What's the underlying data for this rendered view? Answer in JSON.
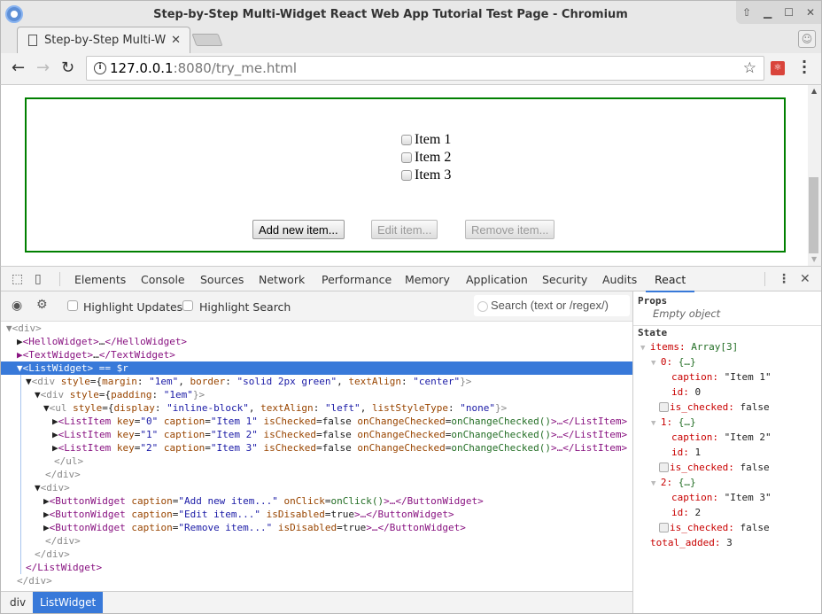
{
  "window": {
    "title": "Step-by-Step Multi-Widget React Web App Tutorial Test Page - Chromium"
  },
  "tab": {
    "label": "Step-by-Step Multi-W"
  },
  "address": {
    "host": "127.0.0.1",
    "rest": ":8080/try_me.html"
  },
  "page": {
    "items": [
      "Item 1",
      "Item 2",
      "Item 3"
    ],
    "buttons": {
      "add": "Add new item...",
      "edit": "Edit item...",
      "remove": "Remove item..."
    },
    "border_color": "#008000"
  },
  "devtools": {
    "tabs": [
      "Elements",
      "Console",
      "Sources",
      "Network",
      "Performance",
      "Memory",
      "Application",
      "Security",
      "Audits",
      "React"
    ],
    "active_tab": "React",
    "highlight_updates": "Highlight Updates",
    "highlight_search": "Highlight Search",
    "search_placeholder": "Search (text or /regex/)",
    "tree": {
      "r0": "<div>",
      "r1a": "<HelloWidget>",
      "r1b": "…",
      "r1c": "</HelloWidget>",
      "r2a": "<TextWidget>",
      "r2b": "…",
      "r2c": "</TextWidget>",
      "r3a": "<ListWidget>",
      "r3b": " == $r",
      "r4a": "<div ",
      "r4b": "style",
      "r4c": "={",
      "r4d": "margin",
      "r4e": ": ",
      "r4f": "\"1em\"",
      "r4g": ", ",
      "r4h": "border",
      "r4i": ": ",
      "r4j": "\"solid 2px green\"",
      "r4k": ", ",
      "r4l": "textAlign",
      "r4m": ": ",
      "r4n": "\"center\"",
      "r4o": "}>",
      "r5a": "<div ",
      "r5b": "style",
      "r5c": "={",
      "r5d": "padding",
      "r5e": ": ",
      "r5f": "\"1em\"",
      "r5g": "}>",
      "r6a": "<ul ",
      "r6b": "style",
      "r6c": "={",
      "r6d": "display",
      "r6e": ": ",
      "r6f": "\"inline-block\"",
      "r6g": ", ",
      "r6h": "textAlign",
      "r6i": ": ",
      "r6j": "\"left\"",
      "r6k": ", ",
      "r6l": "listStyleType",
      "r6m": ": ",
      "r6n": "\"none\"",
      "r6o": "}>",
      "list_items": [
        {
          "key": "\"0\"",
          "caption": "\"Item 1\""
        },
        {
          "key": "\"1\"",
          "caption": "\"Item 2\""
        },
        {
          "key": "\"2\"",
          "caption": "\"Item 3\""
        }
      ],
      "li_tag": "<ListItem",
      "li_key": " key",
      "li_cap": " caption",
      "li_chk": " isChecked",
      "li_false": "false",
      "li_on": " onChangeChecked",
      "li_fn": "onChangeChecked()",
      "li_end": ">…</ListItem>",
      "ul_close": "</ul>",
      "div_close": "</div>",
      "div_open": "<div>",
      "bw_tag": "<ButtonWidget",
      "bw_cap": " caption",
      "bw_add": "\"Add new item...\"",
      "bw_onclick": " onClick",
      "bw_fn": "onClick()",
      "bw_end": ">…</ButtonWidget>",
      "bw_edit": "\"Edit item...\"",
      "bw_rem": "\"Remove item...\"",
      "bw_dis": " isDisabled",
      "bw_true": "true",
      "lw_close": "</ListWidget>"
    },
    "breadcrumbs": [
      "div",
      "ListWidget"
    ],
    "sidebar": {
      "props_label": "Props",
      "props_empty": "Empty object",
      "state_label": "State",
      "items_key": "items",
      "items_val": "Array[3]",
      "entries": [
        {
          "idx": "0",
          "caption": "\"Item 1\"",
          "id": "0",
          "is_checked": "false"
        },
        {
          "idx": "1",
          "caption": "\"Item 2\"",
          "id": "1",
          "is_checked": "false"
        },
        {
          "idx": "2",
          "caption": "\"Item 3\"",
          "id": "2",
          "is_checked": "false"
        }
      ],
      "obj": "{…}",
      "caption_key": "caption",
      "id_key": "id",
      "checked_key": "is_checked",
      "total_key": "total_added",
      "total_val": "3"
    }
  }
}
